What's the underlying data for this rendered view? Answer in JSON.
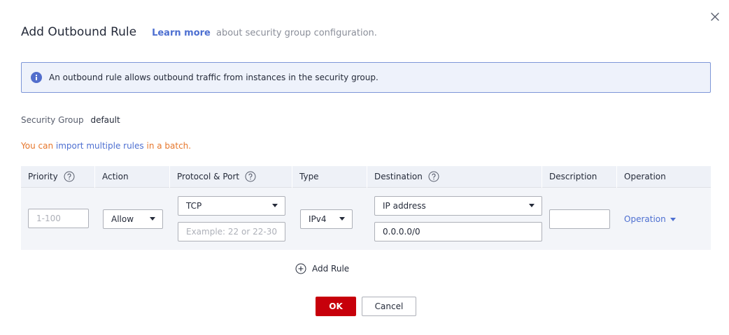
{
  "dialog": {
    "title": "Add Outbound Rule",
    "learn_more": "Learn more",
    "learn_more_suffix": "about security group configuration."
  },
  "info": {
    "icon": "info-icon",
    "text": "An outbound rule allows outbound traffic from instances in the security group."
  },
  "security_group": {
    "label": "Security Group",
    "value": "default"
  },
  "batch": {
    "prefix": "You can",
    "link": "import multiple rules",
    "suffix": "in a batch."
  },
  "table": {
    "headers": {
      "priority": "Priority",
      "action": "Action",
      "protocol_port": "Protocol & Port",
      "type": "Type",
      "destination": "Destination",
      "description": "Description",
      "operation": "Operation"
    },
    "row": {
      "priority_placeholder": "1-100",
      "action": "Allow",
      "protocol": "TCP",
      "port_placeholder": "Example: 22 or 22-30",
      "type": "IPv4",
      "destination_type": "IP address",
      "destination_value": "0.0.0.0/0",
      "description": "",
      "operation": "Operation"
    }
  },
  "add_rule": "Add Rule",
  "buttons": {
    "ok": "OK",
    "cancel": "Cancel"
  },
  "colors": {
    "primary": "#c7000b",
    "link": "#4d6fd1",
    "info_border": "#7d96d8",
    "info_bg": "#eef2fb",
    "warning_text": "#e6762b"
  }
}
